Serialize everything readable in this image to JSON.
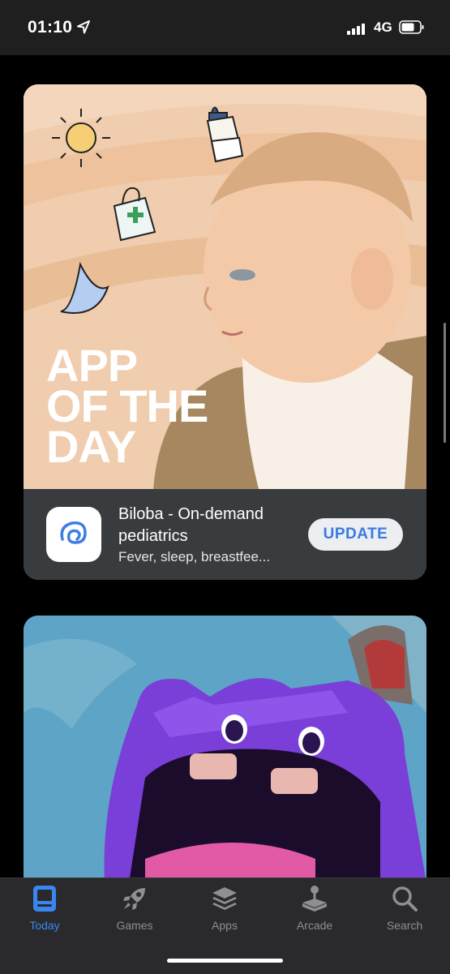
{
  "status_bar": {
    "time": "01:10",
    "network": "4G"
  },
  "featured": {
    "headline": "APP\nOF THE\nDAY",
    "app_name": "Biloba - On-demand pediatrics",
    "subtitle": "Fever, sleep, breastfee...",
    "button_label": "UPDATE",
    "button_text_color": "#3a7be3"
  },
  "tab_bar": {
    "accent": "#3a86f0",
    "tabs": [
      {
        "label": "Today",
        "icon": "today-icon",
        "active": true
      },
      {
        "label": "Games",
        "icon": "rocket-icon",
        "active": false
      },
      {
        "label": "Apps",
        "icon": "layers-icon",
        "active": false
      },
      {
        "label": "Arcade",
        "icon": "joystick-icon",
        "active": false
      },
      {
        "label": "Search",
        "icon": "search-icon",
        "active": false
      }
    ]
  }
}
